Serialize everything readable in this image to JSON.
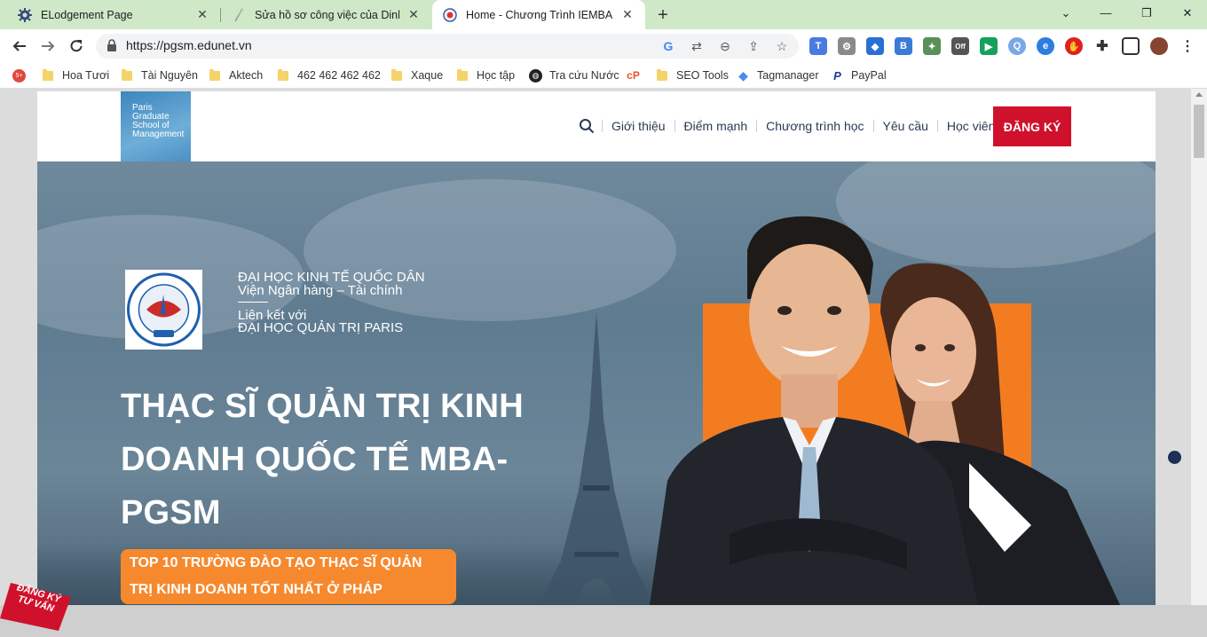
{
  "tabs": [
    {
      "title": "ELodgement Page",
      "icon": "gear-icon",
      "active": false
    },
    {
      "title": "Sửa hồ sơ công việc của Dinh Van",
      "icon": "feather-icon",
      "active": false
    },
    {
      "title": "Home - Chương Trình IEMBA Tha",
      "icon": "site-logo-icon",
      "active": true
    }
  ],
  "address_bar": {
    "url": "https://pgsm.edunet.vn"
  },
  "bookmarks": [
    {
      "label": "Hoa Tươi",
      "type": "folder"
    },
    {
      "label": "Tài Nguyên",
      "type": "folder"
    },
    {
      "label": "Aktech",
      "type": "folder"
    },
    {
      "label": "462 462 462 462",
      "type": "folder"
    },
    {
      "label": "Xaque",
      "type": "folder"
    },
    {
      "label": "Học tập",
      "type": "folder"
    },
    {
      "label": "Tra cứu Nước",
      "type": "globe"
    },
    {
      "label": "",
      "type": "cp"
    },
    {
      "label": "SEO Tools",
      "type": "folder"
    },
    {
      "label": "Tagmanager",
      "type": "tagmanager"
    },
    {
      "label": "PayPal",
      "type": "paypal"
    }
  ],
  "site": {
    "logo_text": [
      "Paris",
      "Graduate",
      "School of",
      "Management"
    ],
    "nav": [
      "Giới thiệu",
      "Điểm mạnh",
      "Chương trình học",
      "Yêu cầu",
      "Học viên"
    ],
    "cta": "ĐĂNG KÝ",
    "hero": {
      "inst_line1": "ĐẠI HỌC KINH TẾ QUỐC DÂN",
      "inst_line2": "Viện Ngân hàng – Tài chính",
      "inst_line3": "Liên kết với",
      "inst_line4": "ĐẠI HỌC QUẢN TRỊ PARIS",
      "headline_1": "THẠC SĨ QUẢN TRỊ KINH",
      "headline_2": "DOANH QUỐC TẾ MBA-",
      "headline_3": "PGSM",
      "badge_1": "TOP 10 TRƯỜNG ĐÀO TẠO THẠC SĨ QUẢN",
      "badge_2": "TRỊ KINH DOANH TỐT NHẤT Ở PHÁP",
      "ribbon_1": "ĐĂNG KÝ",
      "ribbon_2": "TƯ VẤN",
      "neu_logo_text": "ĐẠI HỌC KINH TẾ QUỐC DÂN",
      "neu_logo_abbr": "NEU"
    }
  },
  "colors": {
    "tabstrip": "#cfe8c7",
    "cta": "#d0112b",
    "badge": "#f6892e",
    "hero": "#6f899c",
    "accent_orange": "#f47c20"
  }
}
